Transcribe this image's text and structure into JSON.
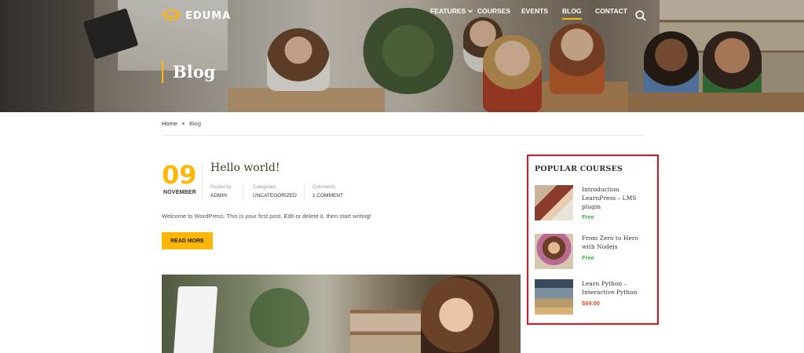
{
  "header": {
    "logo_text": "EDUMA",
    "nav": [
      {
        "label": "FEATURES",
        "has_caret": true
      },
      {
        "label": "COURSES"
      },
      {
        "label": "EVENTS"
      },
      {
        "label": "BLOG",
        "active": true
      },
      {
        "label": "CONTACT"
      }
    ],
    "accent_color": "#ffb606"
  },
  "hero": {
    "title": "Blog"
  },
  "breadcrumb": {
    "home": "Home",
    "current": "Blog"
  },
  "post": {
    "day": "09",
    "month": "NOVEMBER",
    "title": "Hello world!",
    "posted_by_label": "Posted by",
    "posted_by_value": "ADMIN",
    "categories_label": "Categories",
    "categories_value": "UNCATEGORIZED",
    "comments_label": "Comments",
    "comments_value": "1 COMMENT",
    "excerpt": "Welcome to WordPress. This is your first post. Edit or delete it, then start writing!",
    "read_more": "READ MORE"
  },
  "sidebar": {
    "title": "POPULAR COURSES",
    "highlight_color": "#e3101c",
    "courses": [
      {
        "name": "Introduction LearnPress – LMS plugin",
        "price": "Free",
        "price_type": "free"
      },
      {
        "name": "From Zero to Hero with Nodejs",
        "price": "Free",
        "price_type": "free"
      },
      {
        "name": "Learn Python – Interactive Python",
        "price": "$69.00",
        "price_type": "paid"
      }
    ]
  }
}
